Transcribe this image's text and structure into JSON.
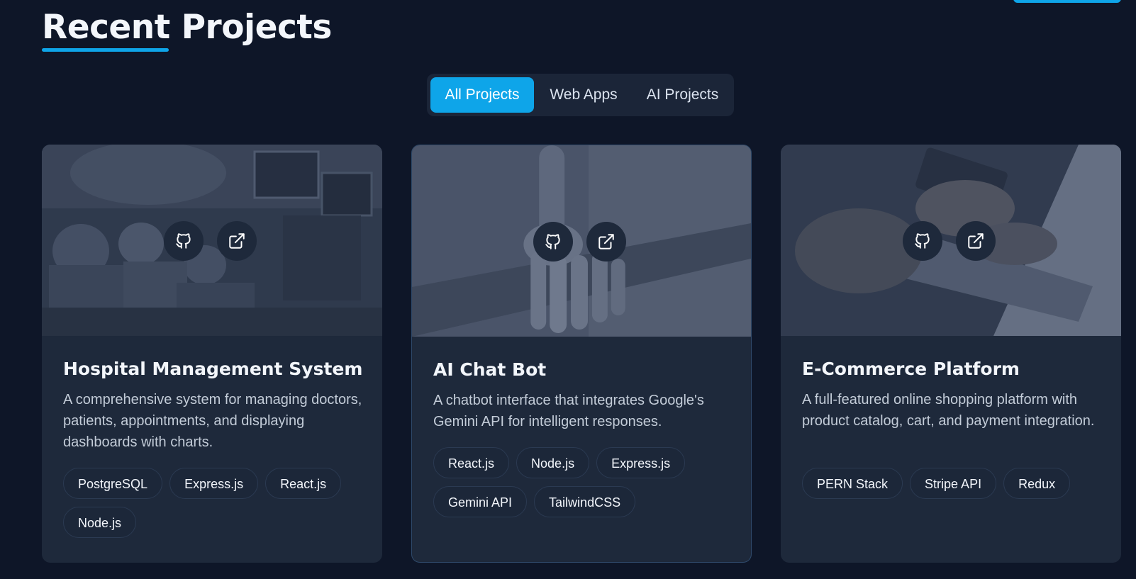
{
  "section": {
    "title": "Recent Projects"
  },
  "filters": [
    {
      "label": "All Projects",
      "active": true
    },
    {
      "label": "Web Apps",
      "active": false
    },
    {
      "label": "AI Projects",
      "active": false
    }
  ],
  "projects": [
    {
      "title": "Hospital Management System",
      "description": "A comprehensive system for managing doctors, patients, appointments, and displaying dashboards with charts.",
      "tags": [
        "PostgreSQL",
        "Express.js",
        "React.js",
        "Node.js"
      ],
      "image": "operating-room-photo",
      "links": [
        "github-icon",
        "external-link-icon"
      ]
    },
    {
      "title": "AI Chat Bot",
      "description": "A chatbot interface that integrates Google's Gemini API for intelligent responses.",
      "tags": [
        "React.js",
        "Node.js",
        "Express.js",
        "Gemini API",
        "TailwindCSS"
      ],
      "image": "robot-hand-photo",
      "links": [
        "github-icon",
        "external-link-icon"
      ]
    },
    {
      "title": "E-Commerce Platform",
      "description": "A full-featured online shopping platform with product catalog, cart, and payment integration.",
      "tags": [
        "PERN Stack",
        "Stripe API",
        "Redux"
      ],
      "image": "laptop-credit-card-photo",
      "links": [
        "github-icon",
        "external-link-icon"
      ]
    }
  ],
  "colors": {
    "accent": "#0ea5e9",
    "background": "#0e1628",
    "card": "#1e293b"
  }
}
